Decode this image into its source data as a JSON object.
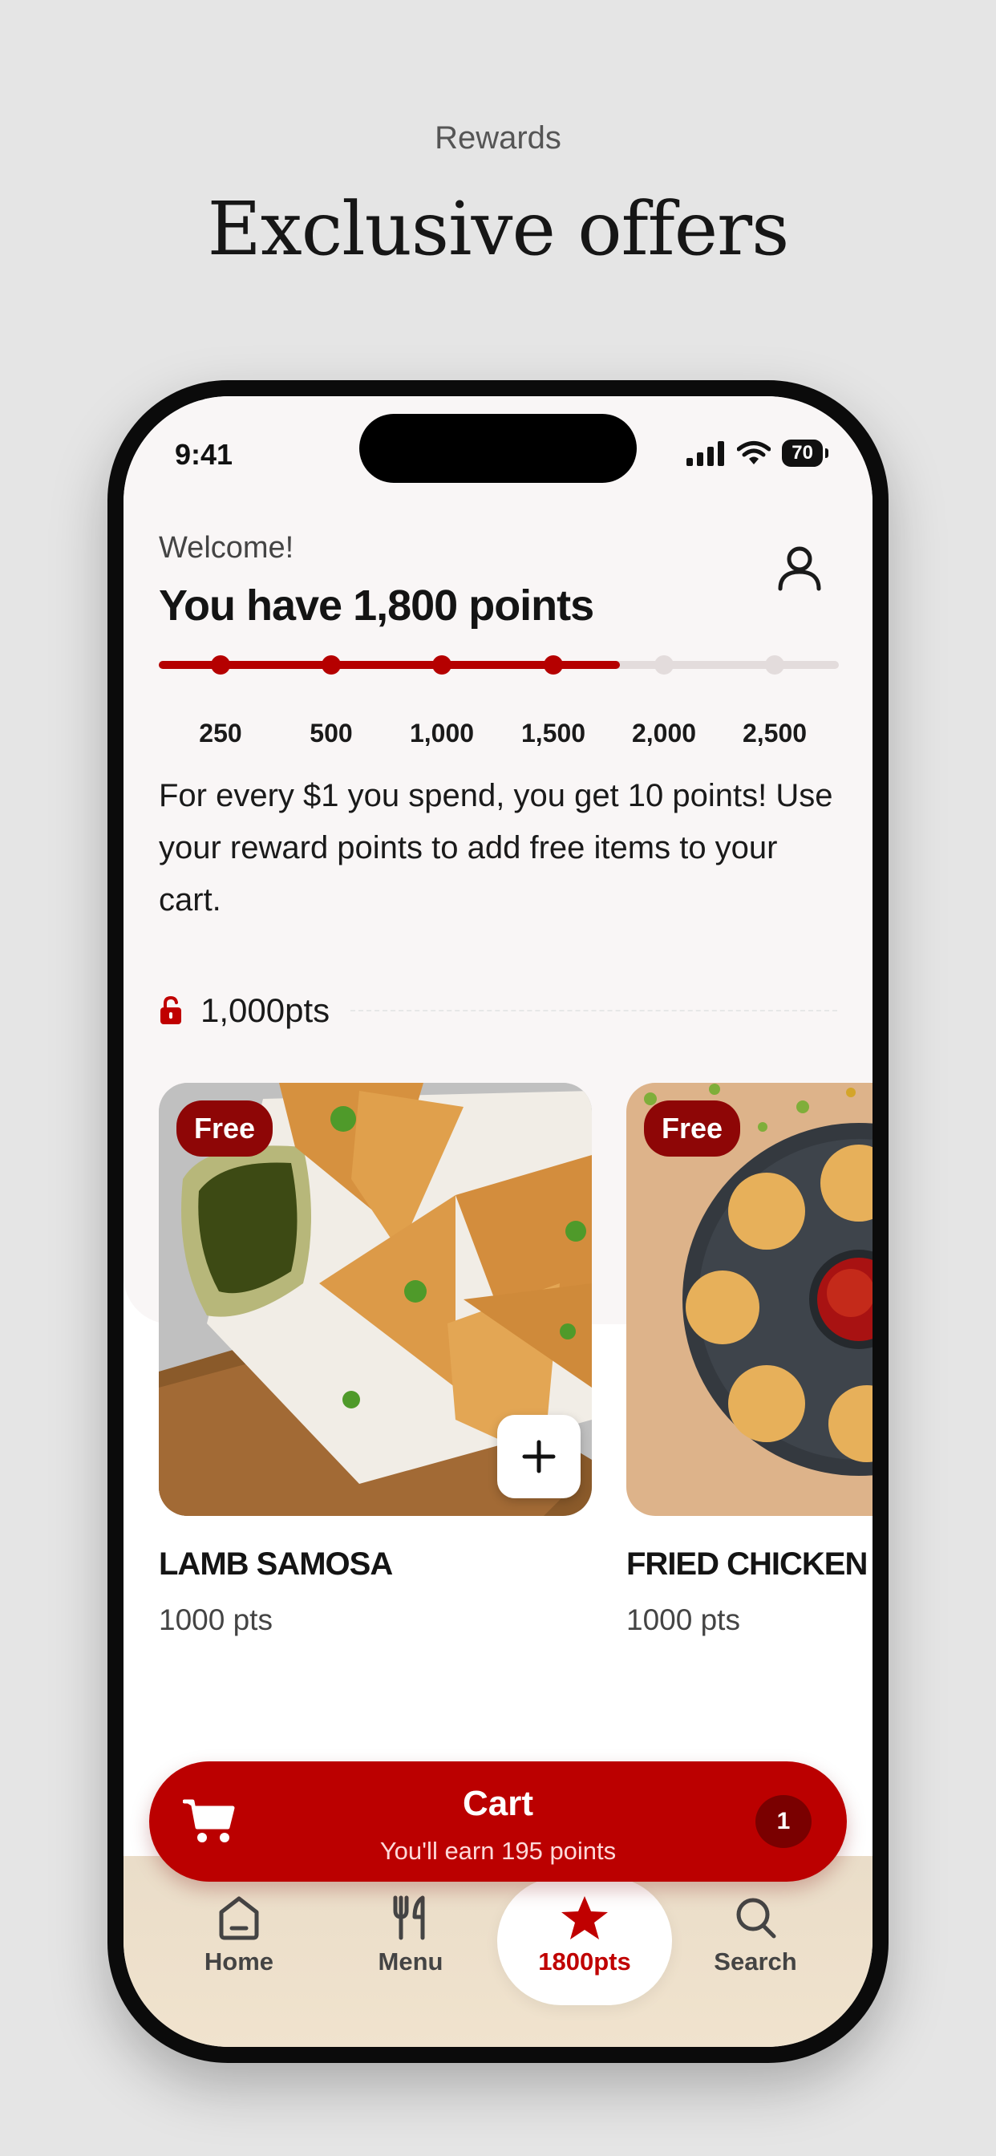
{
  "page": {
    "kicker": "Rewards",
    "headline": "Exclusive offers"
  },
  "status_bar": {
    "time": "9:41",
    "battery": "70"
  },
  "rewards": {
    "welcome": "Welcome!",
    "points_title": "You have 1,800 points",
    "current_points": 1800,
    "milestones": [
      "250",
      "500",
      "1,000",
      "1,500",
      "2,000",
      "2,500"
    ],
    "reached_count": 4,
    "info": "For every $1 you spend, you get 10 points! Use your reward points to add free items to your cart."
  },
  "tier": {
    "label": "1,000pts"
  },
  "products": [
    {
      "badge": "Free",
      "name": "LAMB SAMOSA",
      "points": "1000 pts"
    },
    {
      "badge": "Free",
      "name": "FRIED CHICKEN",
      "points": "1000 pts"
    }
  ],
  "cart": {
    "title": "Cart",
    "subtitle": "You'll earn 195 points",
    "count": "1"
  },
  "tabs": [
    {
      "label": "Home",
      "icon": "home-icon"
    },
    {
      "label": "Menu",
      "icon": "utensils-icon"
    },
    {
      "label": "1800pts",
      "icon": "star-icon",
      "active": true
    },
    {
      "label": "Search",
      "icon": "search-icon"
    }
  ],
  "colors": {
    "brand": "#bb0000",
    "badge": "#8e0606",
    "background": "#e5e5e5"
  }
}
